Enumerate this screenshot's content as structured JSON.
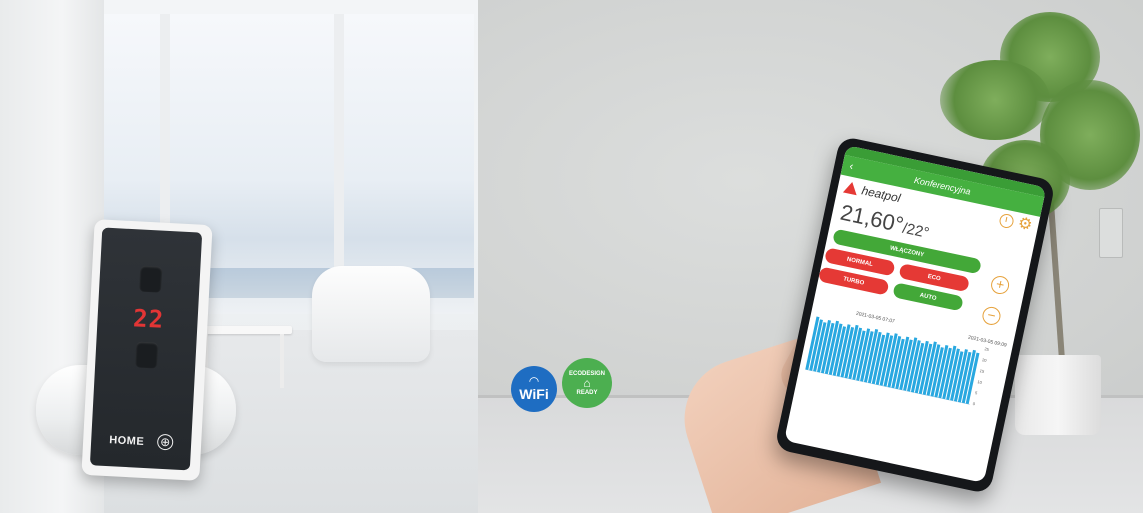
{
  "remote": {
    "display_value": "22",
    "home_label": "HOME",
    "plus_symbol": "⊕"
  },
  "badges": {
    "wifi_label": "WiFi",
    "ecodesign_top": "ECODESIGN",
    "ecodesign_bottom": "READY"
  },
  "phone": {
    "back_symbol": "‹",
    "room_title": "Konferencyjna",
    "brand_name": "heatpol",
    "current_temp": "21,60°",
    "set_temp": "/22°",
    "buttons": {
      "power": "WŁĄCZONY",
      "normal": "NORMAL",
      "eco": "ECO",
      "turbo": "TURBO",
      "auto": "AUTO"
    },
    "plus_symbol": "+",
    "minus_symbol": "−",
    "chart": {
      "date_left": "2021-03-05 07:07",
      "date_right": "2021-03-05 09:09",
      "y_ticks": [
        "25",
        "20",
        "15",
        "10",
        "5",
        "0"
      ]
    }
  },
  "colors": {
    "app_green": "#45b040",
    "button_red": "#e53935",
    "accent_orange": "#e6a23c",
    "chart_blue": "#29a8e0",
    "remote_led": "#e23535",
    "wifi_blue": "#1e6dc2",
    "eco_green": "#4caf50"
  }
}
